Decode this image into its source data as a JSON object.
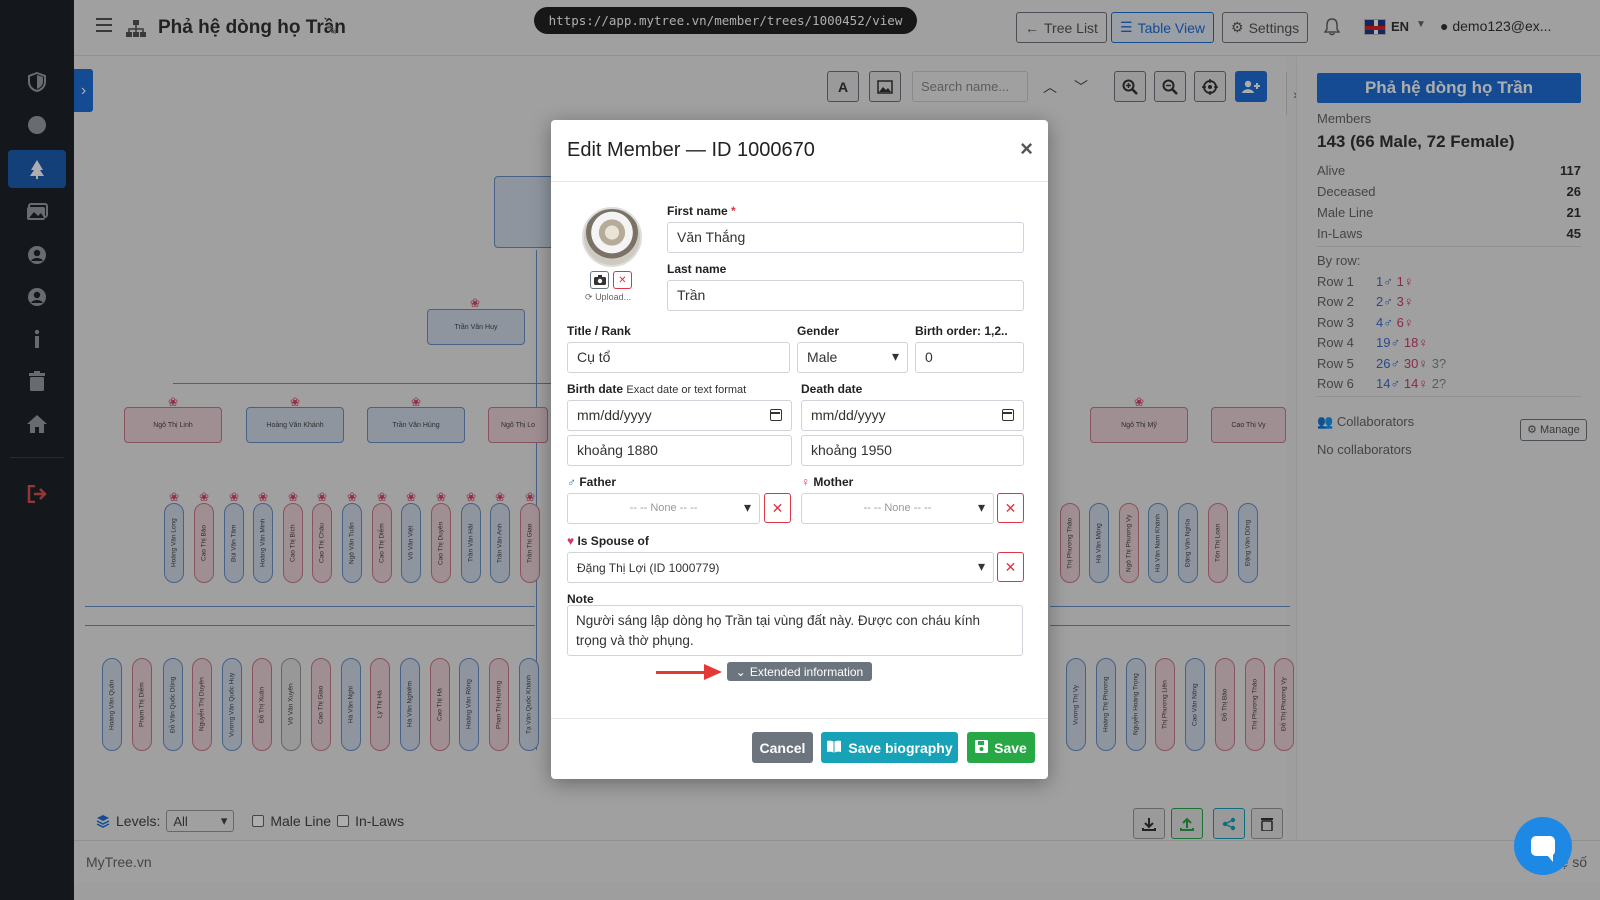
{
  "topbar": {
    "title": "Phả hệ dòng họ Trần",
    "url": "https://app.mytree.vn/member/trees/1000452/view",
    "tree_list": "Tree List",
    "table_view": "Table View",
    "settings": "Settings",
    "lang": "EN",
    "user": "demo123@ex..."
  },
  "canvas": {
    "search_placeholder": "Search name...",
    "levels_label": "Levels:",
    "levels_value": "All",
    "male_line": "Male Line",
    "in_laws": "In-Laws"
  },
  "tree_nodes": {
    "row2": "Trần Văn Huy",
    "row3": [
      "Ngô Thị Linh",
      "Hoàng Văn Khánh",
      "Trần Văn Hùng",
      "Ngô Thị Lo",
      "Ngô Thị Mỹ",
      "Cao Thị Vy"
    ],
    "row4": [
      "Hoàng Văn Long",
      "Cao Thị Bảo",
      "Bùi Văn Tâm",
      "Hoàng Văn Minh",
      "Cao Thị Bích",
      "Cao Thị Châu",
      "Ngô Văn Tuấn",
      "Cao Thị Diễm",
      "Võ Văn Việt",
      "Cao Thị Duyên",
      "Trần Văn Hải",
      "Trần Văn Anh",
      "Trần Thị Giao",
      "Thị Phương Thảo",
      "Hà Văn Mộng",
      "Ngô Thị Phương Vy",
      "Hà Văn Nam Khánh",
      "Đặng Văn Nghĩa",
      "Tôn Thị Loan",
      "Đặng Văn Dũng"
    ],
    "row5": [
      "Hoàng Văn Quân",
      "Phạm Thị Diễm",
      "Đỗ Văn Quốc Dũng",
      "Nguyễn Thị Duyên",
      "Vương Văn Quốc Huy",
      "Đỗ Thị Xuân",
      "Võ Văn Xuyên",
      "Cao Thị Giao",
      "Hà Văn Nghi",
      "Lý Thị Hà",
      "Hà Văn Nghiêm",
      "Cao Thị Hà",
      "Hoàng Văn Rồng",
      "Phan Thị Hương",
      "Tạ Văn Quốc Khánh",
      "Vương Thị Vy",
      "Hoàng Thị Phương",
      "Nguyễn Hoàng Trọng",
      "Thị Phương Liên",
      "Cao Văn Nông",
      "Đỗ Thị Bảo",
      "Thị Phương Thảo",
      "Đỗ Thị Phương Vy"
    ]
  },
  "right_panel": {
    "title": "Phả hệ dòng họ Trần",
    "members_label": "Members",
    "members_value": "143 (66 Male, 72 Female)",
    "stats": [
      {
        "label": "Alive",
        "value": "117"
      },
      {
        "label": "Deceased",
        "value": "26"
      },
      {
        "label": "Male Line",
        "value": "21"
      },
      {
        "label": "In-Laws",
        "value": "45"
      }
    ],
    "by_row_label": "By row:",
    "rows": [
      {
        "label": "Row 1",
        "male": "1♂",
        "female": "1♀",
        "unknown": ""
      },
      {
        "label": "Row 2",
        "male": "2♂",
        "female": "3♀",
        "unknown": ""
      },
      {
        "label": "Row 3",
        "male": "4♂",
        "female": "6♀",
        "unknown": ""
      },
      {
        "label": "Row 4",
        "male": "19♂",
        "female": "18♀",
        "unknown": ""
      },
      {
        "label": "Row 5",
        "male": "26♂",
        "female": "30♀",
        "unknown": "3?"
      },
      {
        "label": "Row 6",
        "male": "14♂",
        "female": "14♀",
        "unknown": "2?"
      }
    ],
    "collaborators_label": "Collaborators",
    "manage": "Manage",
    "no_collaborators": "No collaborators"
  },
  "modal": {
    "title": "Edit Member — ID 1000670",
    "upload": "Upload...",
    "first_name_label": "First name",
    "first_name": "Văn Thắng",
    "last_name_label": "Last name",
    "last_name": "Trần",
    "title_rank_label": "Title / Rank",
    "title_rank": "Cụ tổ",
    "gender_label": "Gender",
    "gender": "Male",
    "birth_order_label": "Birth order: 1,2..",
    "birth_order": "0",
    "birth_date_label": "Birth date",
    "birth_date_hint": "Exact date or text format",
    "birth_date_placeholder": "mm/dd/yyyy",
    "birth_text": "khoảng 1880",
    "death_date_label": "Death date",
    "death_date_placeholder": "mm/dd/yyyy",
    "death_text": "khoảng 1950",
    "father_label": "Father",
    "father_value": "-- -- None -- --",
    "mother_label": "Mother",
    "mother_value": "-- -- None -- --",
    "spouse_label": "Is Spouse of",
    "spouse_value": "Đặng Thị Lợi (ID 1000779)",
    "note_label": "Note",
    "note": "Người sáng lập dòng họ Trần tại vùng đất này. Được con cháu kính trọng và thờ phụng.",
    "extended_info": "Extended information",
    "cancel": "Cancel",
    "save_biography": "Save biography",
    "save": "Save"
  },
  "footer": {
    "left": "MyTree.vn",
    "right": "Phả hệ số"
  },
  "colors": {
    "primary": "#1e6fd9",
    "sidebar": "#1e2329",
    "success": "#28a745",
    "info": "#17a2b8",
    "danger": "#dc3545",
    "secondary": "#6c757d",
    "male_node": "#d3dcea",
    "female_node": "#ecd3d8"
  }
}
